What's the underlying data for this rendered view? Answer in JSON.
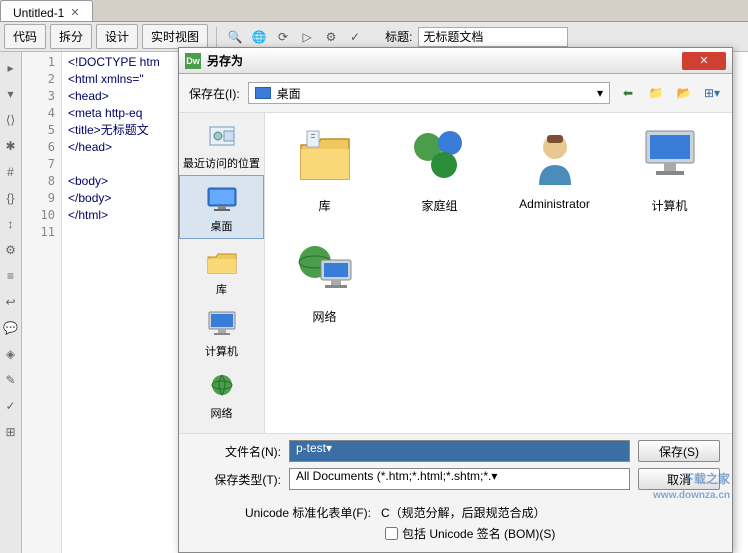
{
  "tab": {
    "title": "Untitled-1"
  },
  "toolbar": {
    "buttons": [
      "代码",
      "拆分",
      "设计",
      "实时视图"
    ],
    "title_label": "标题:",
    "title_value": "无标题文档"
  },
  "code": {
    "lines": [
      "<!DOCTYPE htm",
      "<html xmlns=\"",
      "<head>",
      "<meta http-eq",
      "<title>无标题文",
      "</head>",
      "",
      "<body>",
      "</body>",
      "</html>",
      ""
    ]
  },
  "dialog": {
    "title": "另存为",
    "save_in_label": "保存在(I):",
    "save_in_value": "桌面",
    "places": [
      {
        "id": "recent",
        "label": "最近访问的位置"
      },
      {
        "id": "desktop",
        "label": "桌面"
      },
      {
        "id": "library",
        "label": "库"
      },
      {
        "id": "computer",
        "label": "计算机"
      },
      {
        "id": "network",
        "label": "网络"
      }
    ],
    "folders": [
      {
        "id": "library",
        "label": "库"
      },
      {
        "id": "homegroup",
        "label": "家庭组"
      },
      {
        "id": "admin",
        "label": "Administrator"
      },
      {
        "id": "computer",
        "label": "计算机"
      },
      {
        "id": "network",
        "label": "网络"
      }
    ],
    "filename_label": "文件名(N):",
    "filename_value": "p-test",
    "filetype_label": "保存类型(T):",
    "filetype_value": "All Documents (*.htm;*.html;*.shtm;*.",
    "save_btn": "保存(S)",
    "cancel_btn": "取消",
    "unicode_label": "Unicode 标准化表单(F):",
    "unicode_value": "C（规范分解，后跟规范合成）",
    "bom_label": "包括 Unicode 签名 (BOM)(S)"
  },
  "watermark": {
    "text": "下载之家",
    "url": "www.downza.cn"
  }
}
